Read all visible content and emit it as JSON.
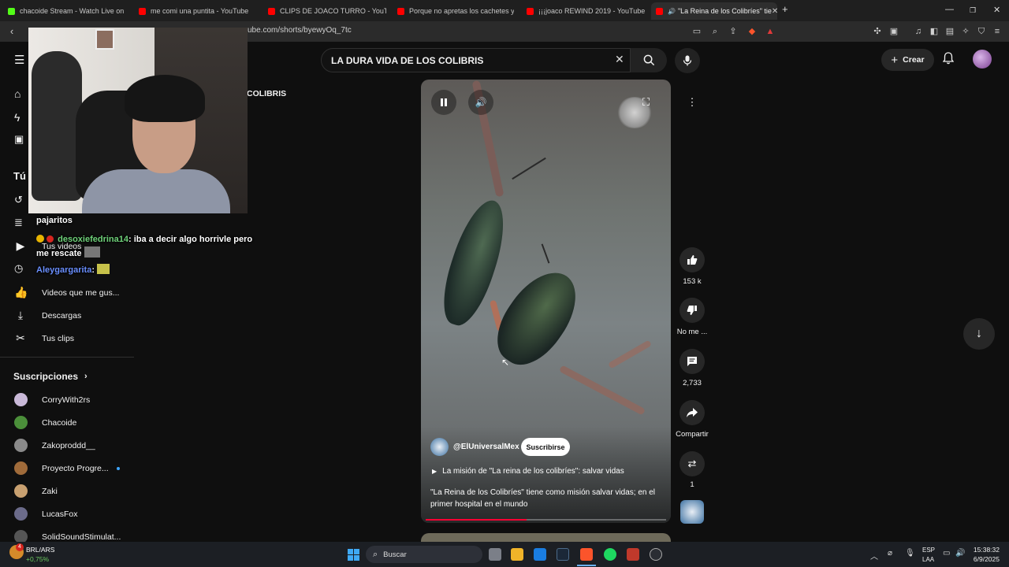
{
  "browser": {
    "tabs": [
      {
        "label": "chacoide Stream - Watch Live on",
        "color": "#53fc18"
      },
      {
        "label": "me comi una puntita - YouTube",
        "color": "#ff0000"
      },
      {
        "label": "CLIPS DE JOACO TURRO - YouTube",
        "color": "#ff0000"
      },
      {
        "label": "Porque no apretas los cachetes y me",
        "color": "#ff0000"
      },
      {
        "label": "¡¡¡joaco REWIND 2019 - YouTube",
        "color": "#ff0000"
      },
      {
        "label": "\"La Reina de los Colibríes\" tie",
        "color": "#ff0000"
      }
    ],
    "url": "ube.com/shorts/byewyOq_7tc",
    "new_tab": "+"
  },
  "youtube": {
    "search_value": "LA DURA VIDA DE LOS COLIBRIS",
    "create_label": "Crear",
    "partial_heading": "COLIBRIS",
    "sidebar": {
      "you_header": "Tú",
      "items": [
        {
          "label": "Tus videos",
          "icon": "play-square-icon"
        },
        {
          "label": "Videos que me gus...",
          "icon": "thumbs-up-icon"
        },
        {
          "label": "Descargas",
          "icon": "download-icon"
        },
        {
          "label": "Tus clips",
          "icon": "scissors-icon"
        }
      ],
      "subscriptions_header": "Suscripciones",
      "subscriptions": [
        {
          "label": "CorryWith2rs",
          "color": "#c9b9d8"
        },
        {
          "label": "Chacoide",
          "color": "#4b8f3a"
        },
        {
          "label": "Zakoproddd__",
          "color": "#8a8a8a"
        },
        {
          "label": "Proyecto Progre...",
          "color": "#a06b3a"
        },
        {
          "label": "Zaki",
          "color": "#c8a070"
        },
        {
          "label": "LucasFox",
          "color": "#6b6b8a"
        },
        {
          "label": "SolidSoundStimulat...",
          "color": "#555"
        }
      ]
    },
    "short": {
      "channel": "@ElUniversalMex",
      "subscribe_label": "Suscribirse",
      "mission_link": "La misión de \"La reina de los colibríes\": salvar vidas",
      "description": "\"La Reina de los Colibríes\" tiene como misión salvar vidas; en el primer hospital en el mundo",
      "progress": 0.42,
      "likes": "153 k",
      "dislike_label": "No me ...",
      "comments": "2,733",
      "share_label": "Compartir",
      "remix_count": "1"
    }
  },
  "overlay": {
    "chat": [
      {
        "user": "",
        "text": "pajaritos"
      },
      {
        "user": "desoxiefedrina14",
        "text": "iba a decir algo horrivle pero me rescate"
      },
      {
        "user": "Aleygargarita",
        "text": ""
      }
    ]
  },
  "taskbar": {
    "stock_name": "BRL/ARS",
    "stock_change": "+0,75%",
    "stock_badge": "4",
    "search_label": "Buscar",
    "lang_top": "ESP",
    "lang_bottom": "LAA",
    "time": "15:38:32",
    "date": "6/9/2025"
  }
}
